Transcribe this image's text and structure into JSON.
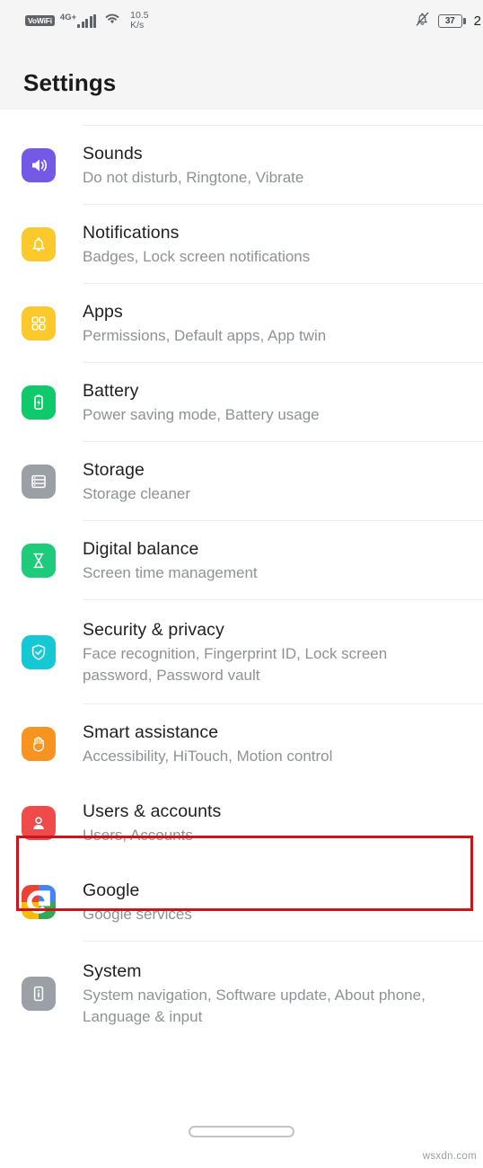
{
  "status_bar": {
    "vowifi_label": "VoWiFi",
    "network_type": "4G+",
    "signal_icon": "signal-bars-icon",
    "wifi_icon": "wifi-icon",
    "network_speed_value": "10.5",
    "network_speed_unit": "K/s",
    "mute_icon": "bell-muted-icon",
    "battery_level": "37",
    "clock_partial": "2"
  },
  "header": {
    "title": "Settings"
  },
  "list": {
    "cut_off_row_text": "",
    "items": [
      {
        "title": "Sounds",
        "subtitle": "Do not disturb, Ringtone, Vibrate",
        "icon": "speaker-icon",
        "icon_color": "#7459e6",
        "divider": true
      },
      {
        "title": "Notifications",
        "subtitle": "Badges, Lock screen notifications",
        "icon": "bell-icon",
        "icon_color": "#fbc92c",
        "divider": true
      },
      {
        "title": "Apps",
        "subtitle": "Permissions, Default apps, App twin",
        "icon": "app-grid-icon",
        "icon_color": "#fbc92c",
        "divider": true
      },
      {
        "title": "Battery",
        "subtitle": "Power saving mode, Battery usage",
        "icon": "battery-bolt-icon",
        "icon_color": "#10c96b",
        "divider": true
      },
      {
        "title": "Storage",
        "subtitle": "Storage cleaner",
        "icon": "storage-icon",
        "icon_color": "#9aa0a6",
        "divider": true
      },
      {
        "title": "Digital balance",
        "subtitle": "Screen time management",
        "icon": "hourglass-icon",
        "icon_color": "#1ecb7b",
        "divider": true
      },
      {
        "title": "Security & privacy",
        "subtitle": "Face recognition, Fingerprint ID, Lock screen password, Password vault",
        "icon": "shield-check-icon",
        "icon_color": "#15c8d4",
        "divider": true
      },
      {
        "title": "Smart assistance",
        "subtitle": "Accessibility, HiTouch, Motion control",
        "icon": "hand-icon",
        "icon_color": "#f79421",
        "divider": false
      },
      {
        "title": "Users & accounts",
        "subtitle": "Users, Accounts",
        "icon": "user-account-icon",
        "icon_color": "#ef4b4b",
        "divider": false,
        "highlighted": true
      },
      {
        "title": "Google",
        "subtitle": "Google services",
        "icon": "google-logo-icon",
        "icon_color": "#ffffff",
        "divider": true
      },
      {
        "title": "System",
        "subtitle": "System navigation, Software update, About phone, Language & input",
        "icon": "phone-info-icon",
        "icon_color": "#9aa0a6",
        "divider": false
      }
    ]
  },
  "annotation": {
    "highlight_color": "#c9161d",
    "highlight_target": "Users & accounts"
  },
  "bottom": {
    "home_indicator": "home-indicator",
    "watermark": "wsxdn.com"
  }
}
